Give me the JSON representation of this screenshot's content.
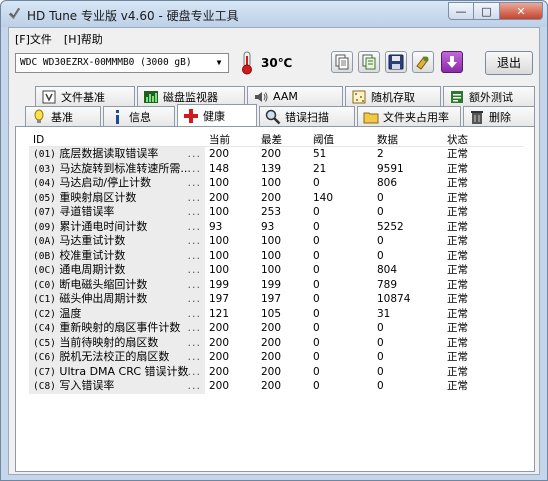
{
  "window": {
    "title": "HD Tune 专业版 v4.60 - 硬盘专业工具",
    "close_glyph": "✕",
    "minimize_glyph": "—",
    "maximize_glyph": "□"
  },
  "menu": [
    {
      "label": "[F]文件"
    },
    {
      "label": "[H]帮助"
    }
  ],
  "toolbar": {
    "drive": "WDC     WD30EZRX-00MMMB0 (3000 gB)",
    "drive_arrow": "▼",
    "temperature": "30℃",
    "exit_label": "退出",
    "icons": [
      "copy-icon",
      "copy-all-icon",
      "save-icon",
      "options-icon",
      "download-icon"
    ]
  },
  "tabs": {
    "row1": [
      {
        "label": "文件基准",
        "icon": "file-benchmark-icon"
      },
      {
        "label": "磁盘监视器",
        "icon": "disk-monitor-icon"
      },
      {
        "label": "AAM",
        "icon": "speaker-icon"
      },
      {
        "label": "随机存取",
        "icon": "random-access-icon"
      },
      {
        "label": "额外测试",
        "icon": "extra-tests-icon"
      }
    ],
    "row2": [
      {
        "label": "基准",
        "icon": "benchmark-icon"
      },
      {
        "label": "信息",
        "icon": "info-icon"
      },
      {
        "label": "健康",
        "icon": "health-cross-icon",
        "active": true
      },
      {
        "label": "错误扫描",
        "icon": "error-scan-icon"
      },
      {
        "label": "文件夹占用率",
        "icon": "folder-usage-icon"
      },
      {
        "label": "删除",
        "icon": "erase-icon"
      }
    ]
  },
  "table": {
    "headers": {
      "id": "ID",
      "current": "当前",
      "worst": "最差",
      "threshold": "阈值",
      "data": "数据",
      "status": "状态"
    },
    "dots": "...",
    "rows": [
      {
        "code": "(01)",
        "name": "底层数据读取错误率",
        "current": "200",
        "worst": "200",
        "threshold": "51",
        "data": "2",
        "status": "正常"
      },
      {
        "code": "(03)",
        "name": "马达旋转到标准转速所需...",
        "current": "148",
        "worst": "139",
        "threshold": "21",
        "data": "9591",
        "status": "正常"
      },
      {
        "code": "(04)",
        "name": "马达启动/停止计数",
        "current": "100",
        "worst": "100",
        "threshold": "0",
        "data": "806",
        "status": "正常"
      },
      {
        "code": "(05)",
        "name": "重映射扇区计数",
        "current": "200",
        "worst": "200",
        "threshold": "140",
        "data": "0",
        "status": "正常"
      },
      {
        "code": "(07)",
        "name": "寻道错误率",
        "current": "100",
        "worst": "253",
        "threshold": "0",
        "data": "0",
        "status": "正常"
      },
      {
        "code": "(09)",
        "name": "累计通电时间计数",
        "current": "93",
        "worst": "93",
        "threshold": "0",
        "data": "5252",
        "status": "正常"
      },
      {
        "code": "(0A)",
        "name": "马达重试计数",
        "current": "100",
        "worst": "100",
        "threshold": "0",
        "data": "0",
        "status": "正常"
      },
      {
        "code": "(0B)",
        "name": "校准重试计数",
        "current": "100",
        "worst": "100",
        "threshold": "0",
        "data": "0",
        "status": "正常"
      },
      {
        "code": "(0C)",
        "name": "通电周期计数",
        "current": "100",
        "worst": "100",
        "threshold": "0",
        "data": "804",
        "status": "正常"
      },
      {
        "code": "(C0)",
        "name": "断电磁头缩回计数",
        "current": "199",
        "worst": "199",
        "threshold": "0",
        "data": "789",
        "status": "正常"
      },
      {
        "code": "(C1)",
        "name": "磁头伸出周期计数",
        "current": "197",
        "worst": "197",
        "threshold": "0",
        "data": "10874",
        "status": "正常"
      },
      {
        "code": "(C2)",
        "name": "温度",
        "current": "121",
        "worst": "105",
        "threshold": "0",
        "data": "31",
        "status": "正常"
      },
      {
        "code": "(C4)",
        "name": "重新映射的扇区事件计数",
        "current": "200",
        "worst": "200",
        "threshold": "0",
        "data": "0",
        "status": "正常"
      },
      {
        "code": "(C5)",
        "name": "当前待映射的扇区数",
        "current": "200",
        "worst": "200",
        "threshold": "0",
        "data": "0",
        "status": "正常"
      },
      {
        "code": "(C6)",
        "name": "脱机无法校正的扇区数",
        "current": "200",
        "worst": "200",
        "threshold": "0",
        "data": "0",
        "status": "正常"
      },
      {
        "code": "(C7)",
        "name": "Ultra DMA CRC 错误计数",
        "current": "200",
        "worst": "200",
        "threshold": "0",
        "data": "0",
        "status": "正常"
      },
      {
        "code": "(C8)",
        "name": "写入错误率",
        "current": "200",
        "worst": "200",
        "threshold": "0",
        "data": "0",
        "status": "正常"
      }
    ]
  }
}
